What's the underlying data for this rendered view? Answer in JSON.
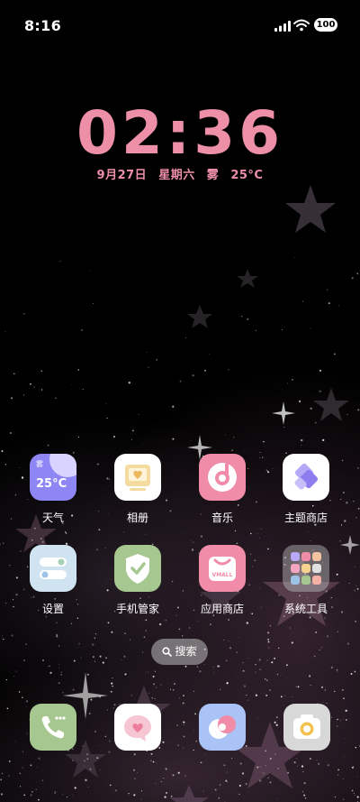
{
  "status_bar": {
    "time": "8:16",
    "battery": "100"
  },
  "clock": {
    "time": "02:36",
    "date": "9月27日",
    "weekday": "星期六",
    "weather": "雾",
    "temperature": "25°C"
  },
  "weather_widget": {
    "condition": "雾",
    "temperature": "25°C"
  },
  "apps": [
    {
      "label": "天气",
      "icon": "weather-icon"
    },
    {
      "label": "相册",
      "icon": "album-icon"
    },
    {
      "label": "音乐",
      "icon": "music-icon"
    },
    {
      "label": "主题商店",
      "icon": "theme-store-icon"
    },
    {
      "label": "设置",
      "icon": "settings-icon"
    },
    {
      "label": "手机管家",
      "icon": "security-shield-icon"
    },
    {
      "label": "应用商店",
      "icon": "app-store-bag-icon"
    },
    {
      "label": "系统工具",
      "icon": "system-tools-folder-icon"
    }
  ],
  "app_store_badge": "VMALL",
  "search": {
    "label": "搜索"
  },
  "dock": [
    {
      "icon": "phone-icon"
    },
    {
      "icon": "messages-icon"
    },
    {
      "icon": "browser-icon"
    },
    {
      "icon": "camera-icon"
    }
  ],
  "colors": {
    "clock_pink": "#ee8fa8",
    "background": "#000000"
  }
}
